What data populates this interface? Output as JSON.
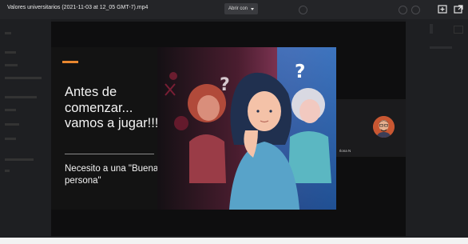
{
  "window": {
    "file_title": "Valores universitarios (2021-11-03 at 12_05 GMT-7).mp4",
    "open_with_label": "Abrir con",
    "icons": [
      "caret-down-icon",
      "add-to-drive-icon",
      "open-in-new-window-icon"
    ]
  },
  "background_panel": {
    "left_items": [
      "",
      "",
      "",
      "",
      "",
      "",
      "",
      "",
      ""
    ]
  },
  "slide": {
    "heading": "Antes de comenzar... vamos a jugar!!!",
    "subheading": "Necesito a una \"Buena persona\"",
    "accent_color": "#e8872f"
  },
  "participant": {
    "name": "Ilona N",
    "avatar_icon": "person-avatar"
  }
}
